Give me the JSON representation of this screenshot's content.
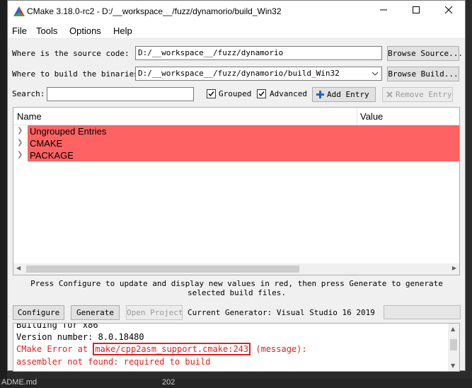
{
  "window": {
    "title": "CMake 3.18.0-rc2 - D:/__workspace__/fuzz/dynamorio/build_Win32"
  },
  "menu": [
    "File",
    "Tools",
    "Options",
    "Help"
  ],
  "source": {
    "label": "Where is the source code:",
    "value": "D:/__workspace__/fuzz/dynamorio",
    "browse": "Browse Source..."
  },
  "build": {
    "label": "Where to build the binaries:",
    "value": "D:/__workspace__/fuzz/dynamorio/build_Win32",
    "browse": "Browse Build..."
  },
  "search": {
    "label": "Search:",
    "value": ""
  },
  "options": {
    "grouped": "Grouped",
    "grouped_checked": true,
    "advanced": "Advanced",
    "advanced_checked": true,
    "add_entry": "Add Entry",
    "remove_entry": "Remove Entry"
  },
  "table": {
    "col_name": "Name",
    "col_value": "Value",
    "rows": [
      "Ungrouped Entries",
      "CMAKE",
      "PACKAGE"
    ],
    "highlight_color": "#ff6262"
  },
  "hint": "Press Configure to update and display new values in red, then press Generate to generate selected build files.",
  "actions": {
    "configure": "Configure",
    "generate": "Generate",
    "open_project": "Open Project",
    "generator": "Current Generator: Visual Studio 16 2019"
  },
  "output": {
    "line1": "Building for x86",
    "line2": "Version number: 8.0.18480",
    "error_prefix": "CMake Error at",
    "error_file": "make/cpp2asm_support.cmake:243",
    "error_suffix": "(message):",
    "line4": "  assembler not found: required to build"
  },
  "background": {
    "taskbar_left": "ADME.md",
    "taskbar_right": "202"
  }
}
